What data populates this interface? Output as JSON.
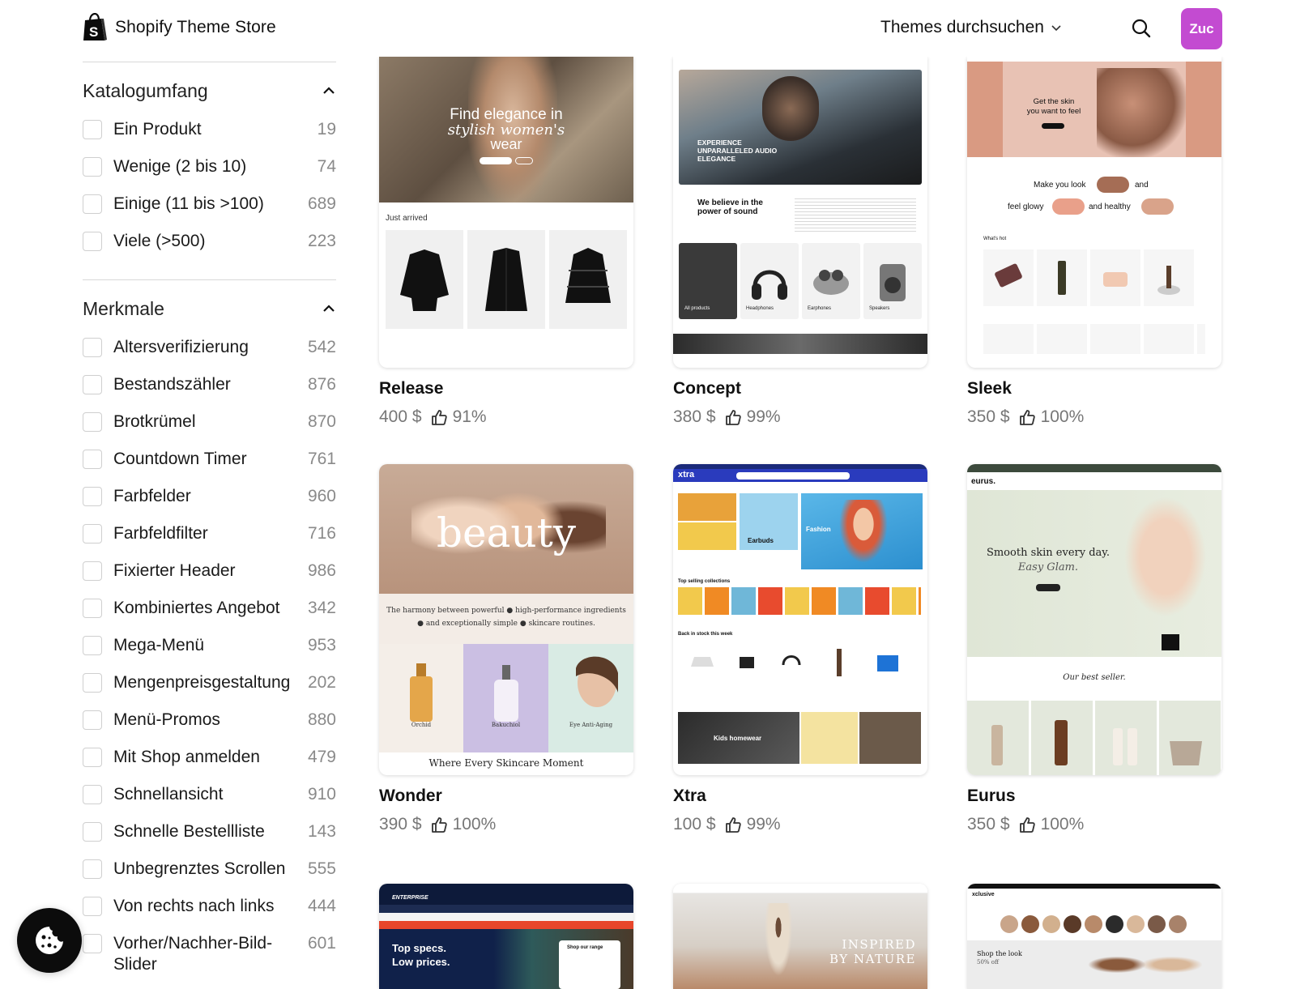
{
  "header": {
    "brand_name": "Shopify Theme Store",
    "browse_label": "Themes durchsuchen",
    "avatar_text": "Zuc",
    "avatar_color": "#c34bd1"
  },
  "sidebar": {
    "sections": [
      {
        "title": "Katalogumfang",
        "items": [
          {
            "label": "Ein Produkt",
            "count": "19"
          },
          {
            "label": "Wenige (2 bis 10)",
            "count": "74"
          },
          {
            "label": "Einige (11 bis >100)",
            "count": "689"
          },
          {
            "label": "Viele (>500)",
            "count": "223"
          }
        ]
      },
      {
        "title": "Merkmale",
        "items": [
          {
            "label": "Altersverifizierung",
            "count": "542"
          },
          {
            "label": "Bestandszähler",
            "count": "876"
          },
          {
            "label": "Brotkrümel",
            "count": "870"
          },
          {
            "label": "Countdown Timer",
            "count": "761"
          },
          {
            "label": "Farbfelder",
            "count": "960"
          },
          {
            "label": "Farbfeldfilter",
            "count": "716"
          },
          {
            "label": "Fixierter Header",
            "count": "986"
          },
          {
            "label": "Kombiniertes Angebot",
            "count": "342"
          },
          {
            "label": "Mega-Menü",
            "count": "953"
          },
          {
            "label": "Mengenpreisgestaltung",
            "count": "202"
          },
          {
            "label": "Menü-Promos",
            "count": "880"
          },
          {
            "label": "Mit Shop anmelden",
            "count": "479"
          },
          {
            "label": "Schnellansicht",
            "count": "910"
          },
          {
            "label": "Schnelle Bestellliste",
            "count": "143"
          },
          {
            "label": "Unbegrenztes Scrollen",
            "count": "555"
          },
          {
            "label": "Von rechts nach links",
            "count": "444"
          },
          {
            "label": "Vorher/Nachher-Bild-Slider",
            "count": "601"
          }
        ]
      }
    ]
  },
  "themes": [
    {
      "name": "Release",
      "price": "400 $",
      "rating": "91%"
    },
    {
      "name": "Concept",
      "price": "380 $",
      "rating": "99%"
    },
    {
      "name": "Sleek",
      "price": "350 $",
      "rating": "100%"
    },
    {
      "name": "Wonder",
      "price": "390 $",
      "rating": "100%"
    },
    {
      "name": "Xtra",
      "price": "100 $",
      "rating": "99%"
    },
    {
      "name": "Eurus",
      "price": "350 $",
      "rating": "100%"
    }
  ],
  "previews": {
    "release": {
      "hero_line1": "Find elegance in",
      "hero_line2": "stylish women's",
      "hero_line3": "wear",
      "section": "Just arrived"
    },
    "concept": {
      "hero": "EXPERIENCE UNPARALLELED AUDIO ELEGANCE",
      "tagline_1": "We believe in the",
      "tagline_2": "power of sound",
      "tiles": [
        "All products",
        "Headphones",
        "Earphones",
        "Speakers"
      ]
    },
    "sleek": {
      "hero_1": "Get the skin",
      "hero_2": "you want to feel",
      "mid_1": "Make you look",
      "mid_and": "and",
      "mid_2": "feel glowy",
      "mid_3": "and healthy",
      "tab": "What's hot"
    },
    "wonder": {
      "hero": "beauty",
      "line_1": "The harmony between powerful",
      "line_1b": "high-performance ingredients",
      "line_2": "and exceptionally simple",
      "line_2b": "skincare routines.",
      "products": [
        "Orchid",
        "Bakuchiol",
        "Eye Anti-Aging"
      ],
      "footer": "Where Every Skincare Moment"
    },
    "xtra": {
      "logo": "xtra",
      "hero_fashion": "Fashion",
      "hero_earbuds": "Earbuds",
      "row_1": "Top selling collections",
      "row_2": "Back in stock this week",
      "banner": "Kids homewear"
    },
    "eurus": {
      "logo": "eurus.",
      "hero_1": "Smooth skin every day.",
      "hero_2": "Easy Glam.",
      "section": "Our best seller."
    },
    "enterprise": {
      "logo": "ENTERPRISE",
      "hero_1": "Top specs.",
      "hero_2": "Low prices.",
      "box": "Shop our range"
    },
    "nature": {
      "hero_1": "INSPIRED",
      "hero_2": "BY NATURE"
    },
    "exclusive": {
      "logo": "xclusive",
      "hero": "Shop the look",
      "sub": "50% off"
    }
  }
}
